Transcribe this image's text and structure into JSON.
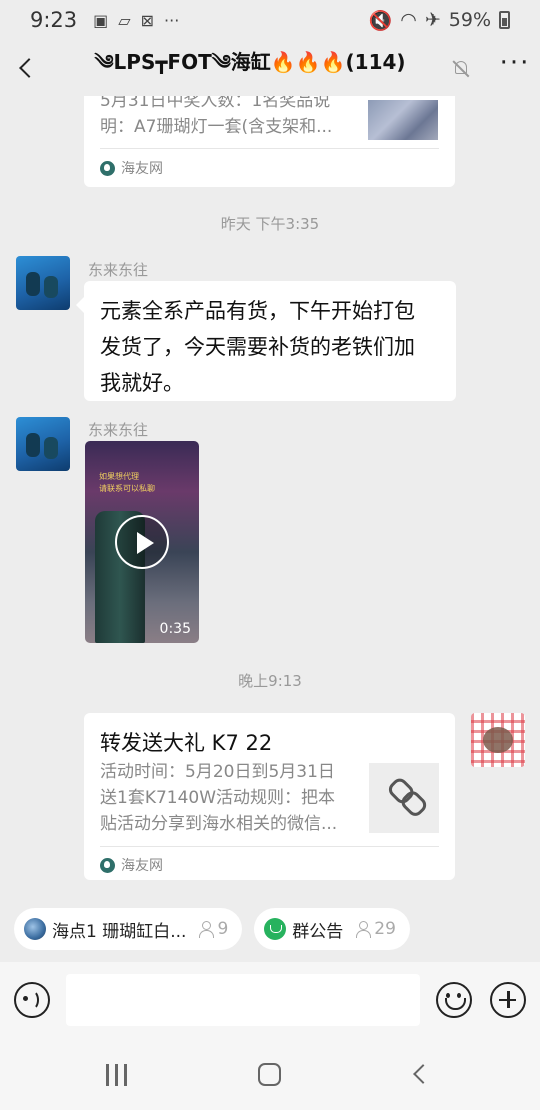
{
  "status_bar": {
    "time": "9:23",
    "battery": "59%",
    "left_icons": [
      "image-icon",
      "folder-icon",
      "network-icon",
      "more-dots-icon"
    ],
    "right_icons": [
      "mute-icon",
      "wifi-icon",
      "airplane-icon",
      "battery-icon"
    ]
  },
  "header": {
    "title": "༄LPS┳FOT༄海缸🔥🔥🔥(114)",
    "more_label": "···"
  },
  "messages": {
    "prev_card": {
      "desc_line1": "5月31日中奖人数：1名奖品说",
      "desc_line2": "明：A7珊瑚灯一套(含支架和...",
      "source": "海友网"
    },
    "timestamp_1": "昨天 下午3:35",
    "msg1": {
      "sender": "东来东往",
      "lines": [
        "元素全系产品有货，下午开始打包",
        "发货了，今天需要补货的老铁们加",
        "我就好。"
      ]
    },
    "msg2": {
      "sender": "东来东往",
      "duration": "0:35",
      "overlay": "如果想代理",
      "overlay2": "请联系可以私聊"
    },
    "timestamp_2": "晚上9:13",
    "link_card": {
      "title": "转发送大礼 K7 22",
      "desc_lines": [
        "活动时间：5月20日到5月31日",
        "送1套K7140W活动规则：把本",
        "贴活动分享到海水相关的微信..."
      ],
      "source": "海友网"
    }
  },
  "chips": [
    {
      "label": "海点1 珊瑚缸白...",
      "count": "9"
    },
    {
      "label": "群公告",
      "count": "29"
    }
  ],
  "input": {
    "placeholder": ""
  }
}
